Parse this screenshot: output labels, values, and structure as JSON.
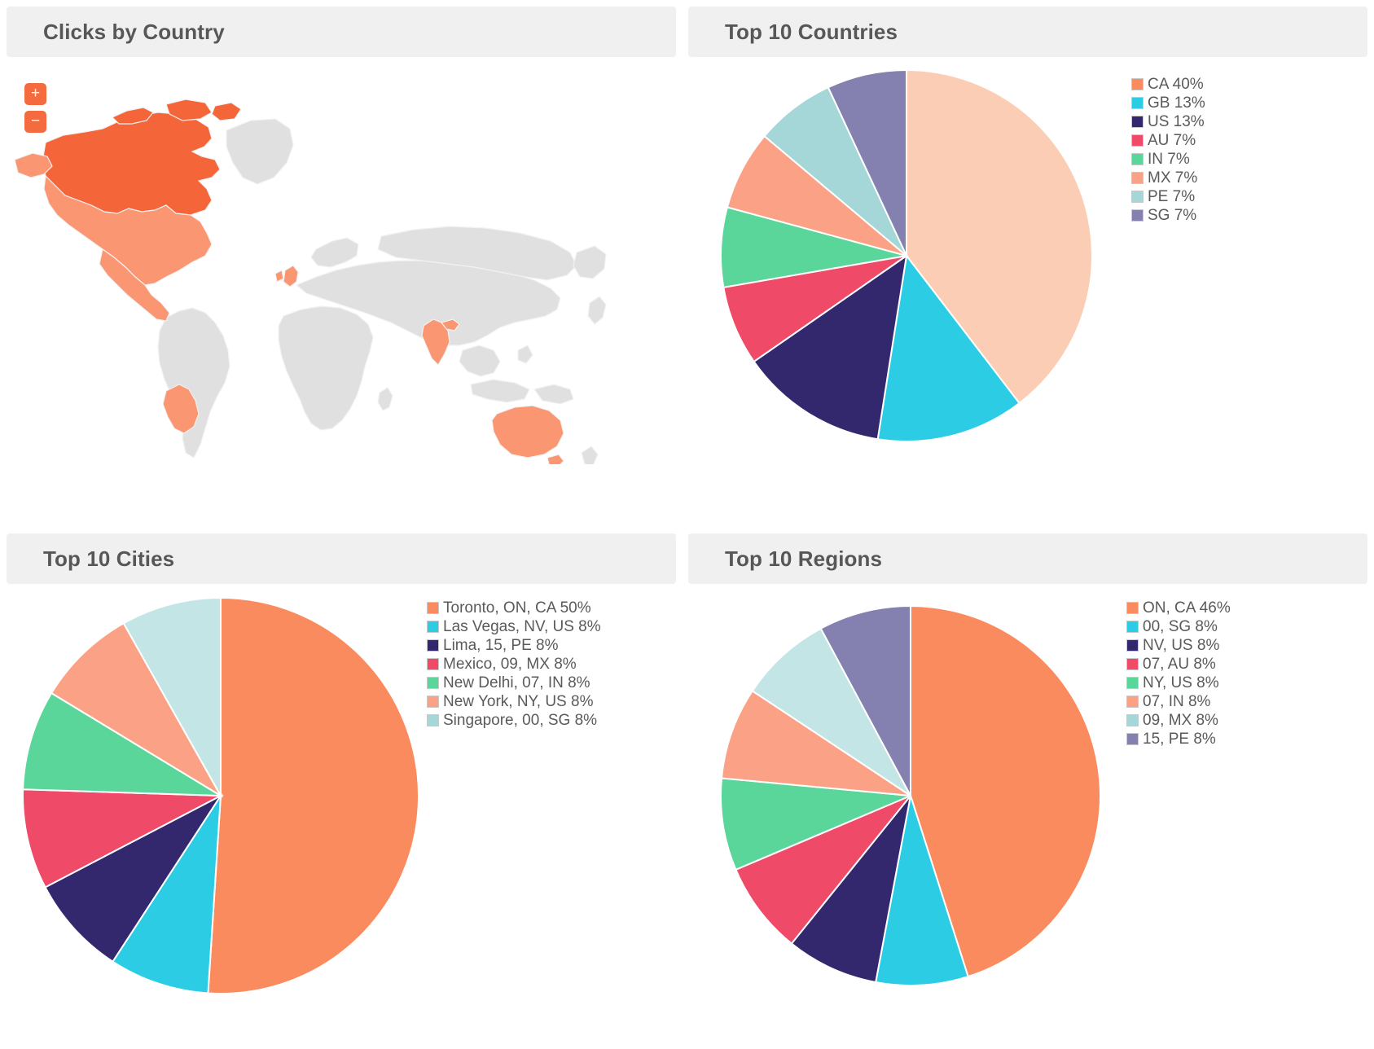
{
  "panels": {
    "map": {
      "title": "Clicks by Country"
    },
    "countries": {
      "title": "Top 10 Countries"
    },
    "cities": {
      "title": "Top 10 Cities"
    },
    "regions": {
      "title": "Top 10 Regions"
    }
  },
  "map_controls": {
    "zoom_in": "+",
    "zoom_out": "−"
  },
  "colors": {
    "highlight_strong": "#f4663a",
    "highlight_light": "#fa9671",
    "map_base": "#e0e0e0",
    "map_border": "#f2f2f2",
    "ocean": "#ffffff",
    "panel_header": "#f0f0f0",
    "title_text": "#575757",
    "legend_text": "#5a5a5a",
    "control_orange": "#f36b3e"
  },
  "map_data": {
    "highlighted_strong": [
      "CA"
    ],
    "highlighted_light": [
      "US",
      "MX",
      "PE",
      "GB",
      "IN",
      "AU"
    ]
  },
  "chart_data": [
    {
      "id": "countries",
      "type": "pie",
      "title": "Top 10 Countries",
      "legend_position": "right",
      "labels": [
        "CA 40%",
        "GB 13%",
        "US 13%",
        "AU 7%",
        "IN 7%",
        "MX 7%",
        "PE 7%",
        "SG 7%"
      ],
      "categories": [
        "CA",
        "GB",
        "US",
        "AU",
        "IN",
        "MX",
        "PE",
        "SG"
      ],
      "values": [
        40,
        13,
        13,
        7,
        7,
        7,
        7,
        7
      ],
      "slice_colors": [
        "#fbcdb5",
        "#2ccce4",
        "#33276e",
        "#ef4a68",
        "#5ad69b",
        "#fba286",
        "#a5d6d8",
        "#8480b0"
      ],
      "legend_colors": [
        "#fa8b5e",
        "#2ccce4",
        "#33276e",
        "#ef4a68",
        "#5ad69b",
        "#fba286",
        "#a5d6d8",
        "#8480b0"
      ]
    },
    {
      "id": "cities",
      "type": "pie",
      "title": "Top 10 Cities",
      "legend_position": "right",
      "labels": [
        "Toronto, ON, CA 50%",
        "Las Vegas, NV, US 8%",
        "Lima, 15, PE 8%",
        "Mexico, 09, MX 8%",
        "New Delhi, 07, IN 8%",
        "New York, NY, US 8%",
        "Singapore, 00, SG 8%"
      ],
      "categories": [
        "Toronto, ON, CA",
        "Las Vegas, NV, US",
        "Lima, 15, PE",
        "Mexico, 09, MX",
        "New Delhi, 07, IN",
        "New York, NY, US",
        "Singapore, 00, SG"
      ],
      "values": [
        50,
        8,
        8,
        8,
        8,
        8,
        8
      ],
      "slice_colors": [
        "#fa8b5e",
        "#2ccce4",
        "#33276e",
        "#ef4a68",
        "#5ad69b",
        "#fba286",
        "#c4e5e6"
      ],
      "legend_colors": [
        "#fa8b5e",
        "#2ccce4",
        "#33276e",
        "#ef4a68",
        "#5ad69b",
        "#fba286",
        "#a5d6d8"
      ]
    },
    {
      "id": "regions",
      "type": "pie",
      "title": "Top 10 Regions",
      "legend_position": "right",
      "labels": [
        "ON, CA 46%",
        "00, SG 8%",
        "NV, US 8%",
        "07, AU 8%",
        "NY, US 8%",
        "07, IN 8%",
        "09, MX 8%",
        "15, PE 8%"
      ],
      "categories": [
        "ON, CA",
        "00, SG",
        "NV, US",
        "07, AU",
        "NY, US",
        "07, IN",
        "09, MX",
        "15, PE"
      ],
      "values": [
        46,
        8,
        8,
        8,
        8,
        8,
        8,
        8
      ],
      "slice_colors": [
        "#fa8b5e",
        "#2ccce4",
        "#33276e",
        "#ef4a68",
        "#5ad69b",
        "#fba286",
        "#c4e5e6",
        "#8480b0"
      ],
      "legend_colors": [
        "#fa8b5e",
        "#2ccce4",
        "#33276e",
        "#ef4a68",
        "#5ad69b",
        "#fba286",
        "#a5d6d8",
        "#8480b0"
      ]
    }
  ]
}
